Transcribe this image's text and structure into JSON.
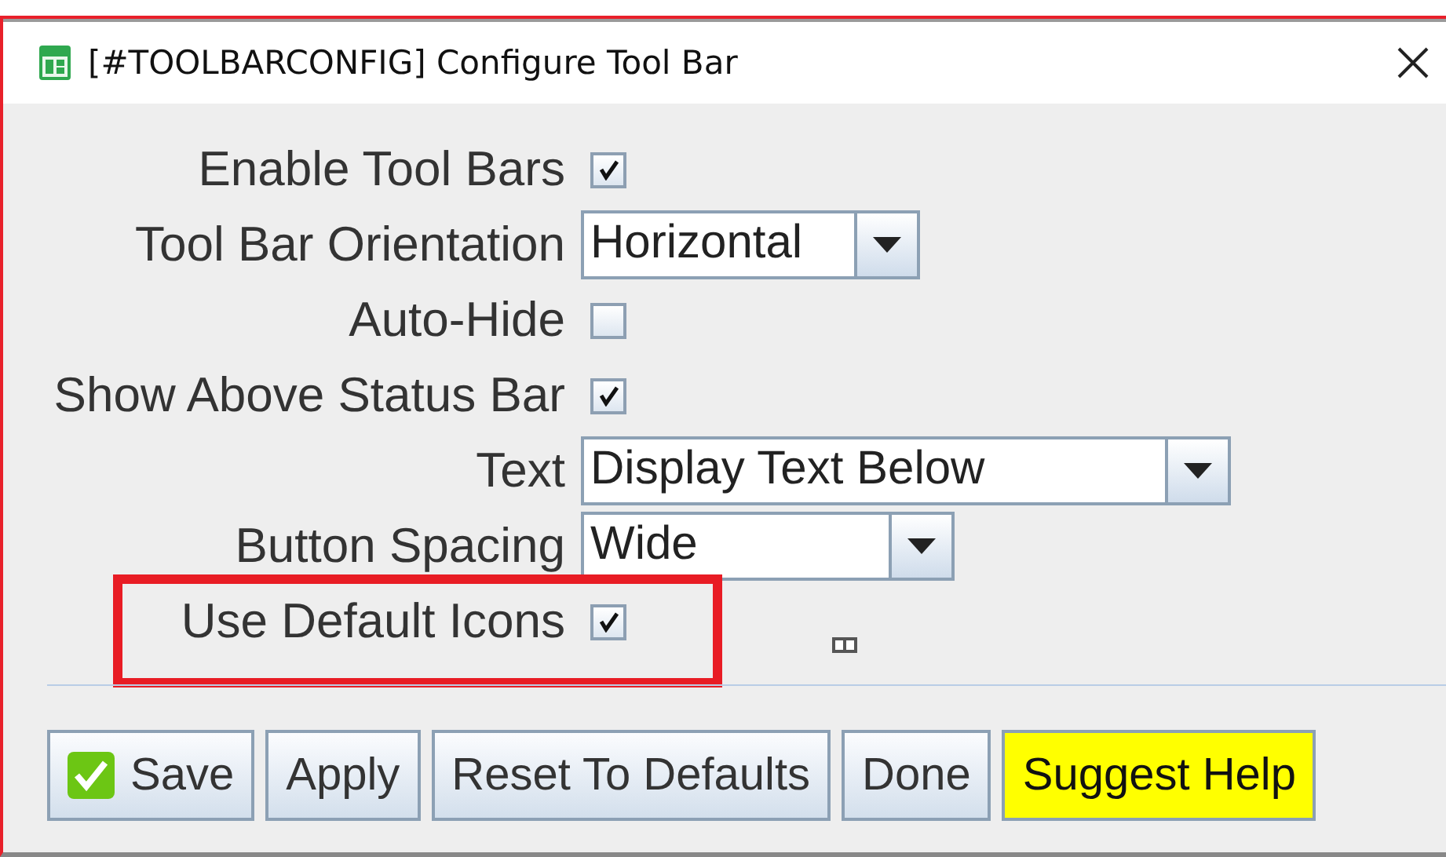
{
  "window": {
    "title": "[#TOOLBARCONFIG] Configure Tool Bar"
  },
  "fields": [
    {
      "kind": "checkbox",
      "label": "Enable Tool Bars",
      "checked": true,
      "highlighted": false
    },
    {
      "kind": "dropdown",
      "label": "Tool Bar Orientation",
      "value": "Horizontal",
      "highlighted": false
    },
    {
      "kind": "checkbox",
      "label": "Auto-Hide",
      "checked": false,
      "highlighted": false
    },
    {
      "kind": "checkbox",
      "label": "Show Above Status Bar",
      "checked": true,
      "highlighted": false
    },
    {
      "kind": "dropdown",
      "label": "Text",
      "value": "Display Text Below",
      "highlighted": false
    },
    {
      "kind": "dropdown",
      "label": "Button Spacing",
      "value": "Wide",
      "highlighted": false
    },
    {
      "kind": "checkbox",
      "label": "Use Default Icons",
      "checked": true,
      "highlighted": true
    }
  ],
  "buttons": [
    {
      "kind": "save",
      "label": "Save"
    },
    {
      "kind": "plain",
      "label": "Apply"
    },
    {
      "kind": "plain",
      "label": "Reset To Defaults"
    },
    {
      "kind": "plain",
      "label": "Done"
    },
    {
      "kind": "help",
      "label": "Suggest Help"
    }
  ]
}
